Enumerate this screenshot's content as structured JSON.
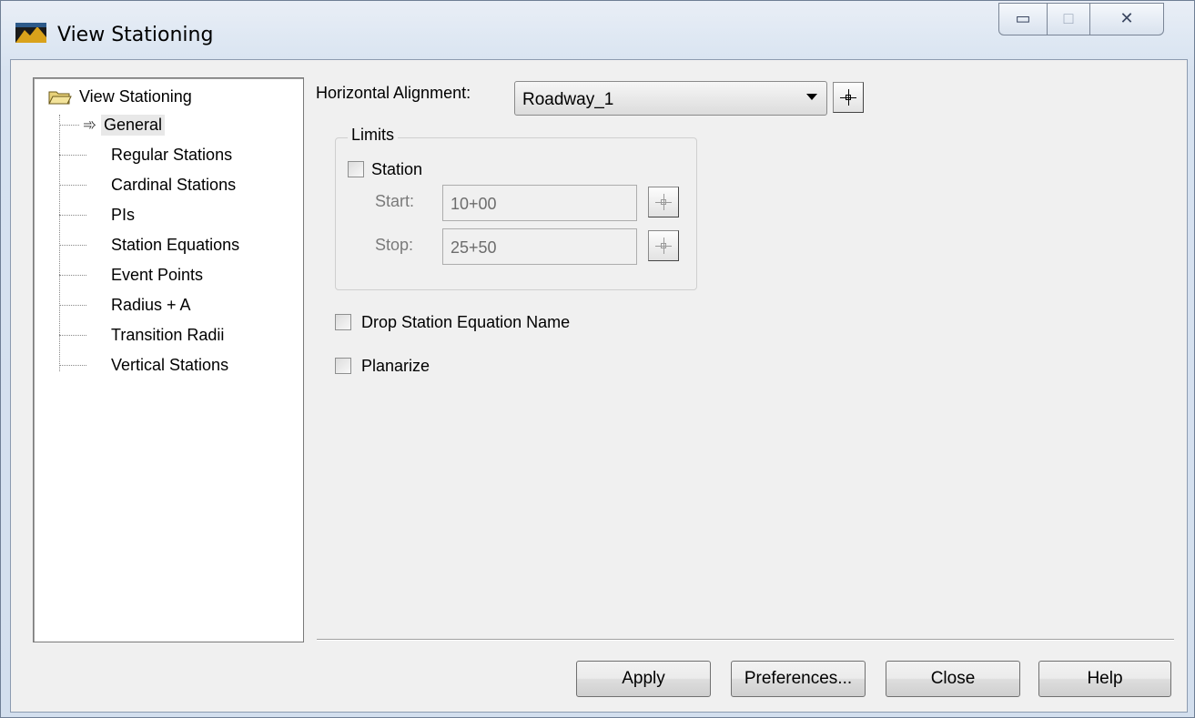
{
  "window": {
    "title": "View Stationing",
    "minimize_glyph": "▭",
    "maximize_glyph": "□",
    "close_glyph": "✕"
  },
  "tree": {
    "root_label": "View Stationing",
    "items": [
      {
        "label": "General",
        "selected": true
      },
      {
        "label": "Regular Stations"
      },
      {
        "label": "Cardinal Stations"
      },
      {
        "label": "PIs"
      },
      {
        "label": "Station Equations"
      },
      {
        "label": "Event Points"
      },
      {
        "label": "Radius + A"
      },
      {
        "label": "Transition Radii"
      },
      {
        "label": "Vertical Stations"
      }
    ],
    "selected_arrow": "➾"
  },
  "general": {
    "alignment_label": "Horizontal Alignment:",
    "alignment_value": "Roadway_1",
    "limits": {
      "title": "Limits",
      "station_label": "Station",
      "station_checked": false,
      "start_label": "Start:",
      "start_value": "10+00",
      "stop_label": "Stop:",
      "stop_value": "25+50"
    },
    "drop_equation_label": "Drop Station Equation Name",
    "drop_equation_checked": false,
    "planarize_label": "Planarize",
    "planarize_checked": false
  },
  "buttons": {
    "apply": "Apply",
    "preferences": "Preferences...",
    "close": "Close",
    "help": "Help"
  },
  "colors": {
    "title_bar": "#dfe8f3",
    "client_bg": "#f0f0f0"
  }
}
